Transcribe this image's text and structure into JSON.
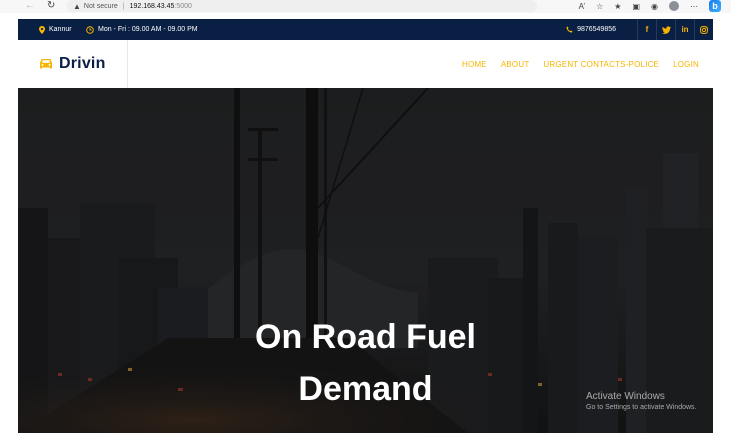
{
  "browser": {
    "security": "Not secure",
    "separator": "|",
    "host": "192.168.43.45",
    "port": ":5000"
  },
  "topbar": {
    "location": "Kannur",
    "hours": "Mon - Fri : 09.00 AM - 09.00 PM",
    "phone": "9876549856",
    "social": [
      "f",
      "t",
      "in",
      "ig"
    ]
  },
  "header": {
    "brand": "Drivin",
    "menu": [
      "HOME",
      "ABOUT",
      "URGENT CONTACTS-POLICE",
      "LOGIN"
    ]
  },
  "hero": {
    "title_line1": "On Road Fuel",
    "title_line2": "Demand"
  },
  "watermark": {
    "line1": "Activate Windows",
    "line2": "Go to Settings to activate Windows."
  },
  "colors": {
    "navy": "#0a1f44",
    "accent": "#f6b500"
  }
}
